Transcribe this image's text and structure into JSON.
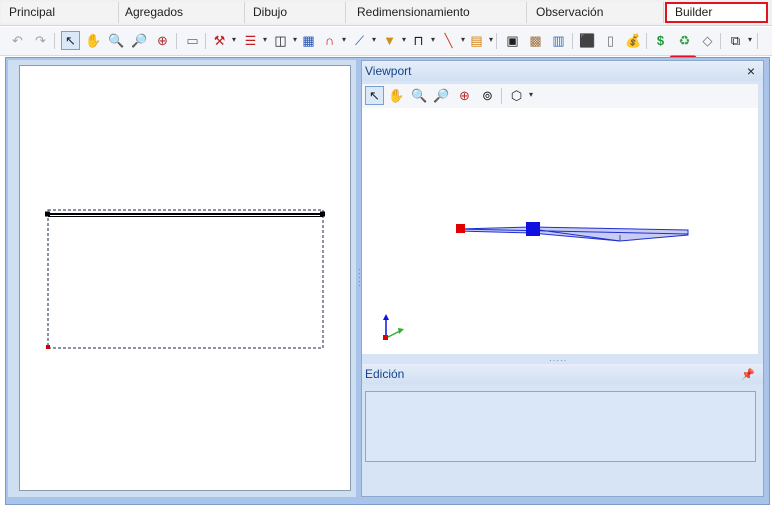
{
  "tabs": [
    {
      "label": "Principal",
      "active": false
    },
    {
      "label": "Agregados",
      "active": false
    },
    {
      "label": "Dibujo",
      "active": false
    },
    {
      "label": "Redimensionamiento",
      "active": false
    },
    {
      "label": "Observación",
      "active": false
    },
    {
      "label": "Builder",
      "active": true
    }
  ],
  "toolbar": {
    "icons": [
      "undo-icon",
      "redo-icon",
      "select-pointer-icon",
      "pan-hand-icon",
      "zoom-in-icon",
      "zoom-out-icon",
      "zoom-extents-icon",
      "new-element-icon",
      "drill-icon",
      "table-rows-icon",
      "columns-icon",
      "grid-edit-icon",
      "magnet-icon",
      "polyline-icon",
      "fill-icon",
      "frame-icon",
      "line-icon",
      "layers-icon",
      "calculator-icon",
      "grid-icon",
      "panels-icon",
      "box-3d-icon",
      "cabinet-icon",
      "money-bag-icon",
      "dollar-icon",
      "recycle-icon",
      "eraser-icon",
      "window-icon"
    ]
  },
  "viewport": {
    "title": "Viewport",
    "close_glyph": "×",
    "icons": [
      "select-pointer-icon",
      "pan-hand-icon",
      "zoom-in-icon",
      "zoom-out-icon",
      "zoom-extents-icon",
      "orbit-icon",
      "view-cube-icon"
    ]
  },
  "edition": {
    "title": "Edición",
    "pin_glyph": "📌"
  },
  "colors": {
    "accent_red": "#e0141e",
    "panel_blue": "#a9c4e8",
    "header_text": "#15428b",
    "model_blue": "#1f2fd0"
  }
}
